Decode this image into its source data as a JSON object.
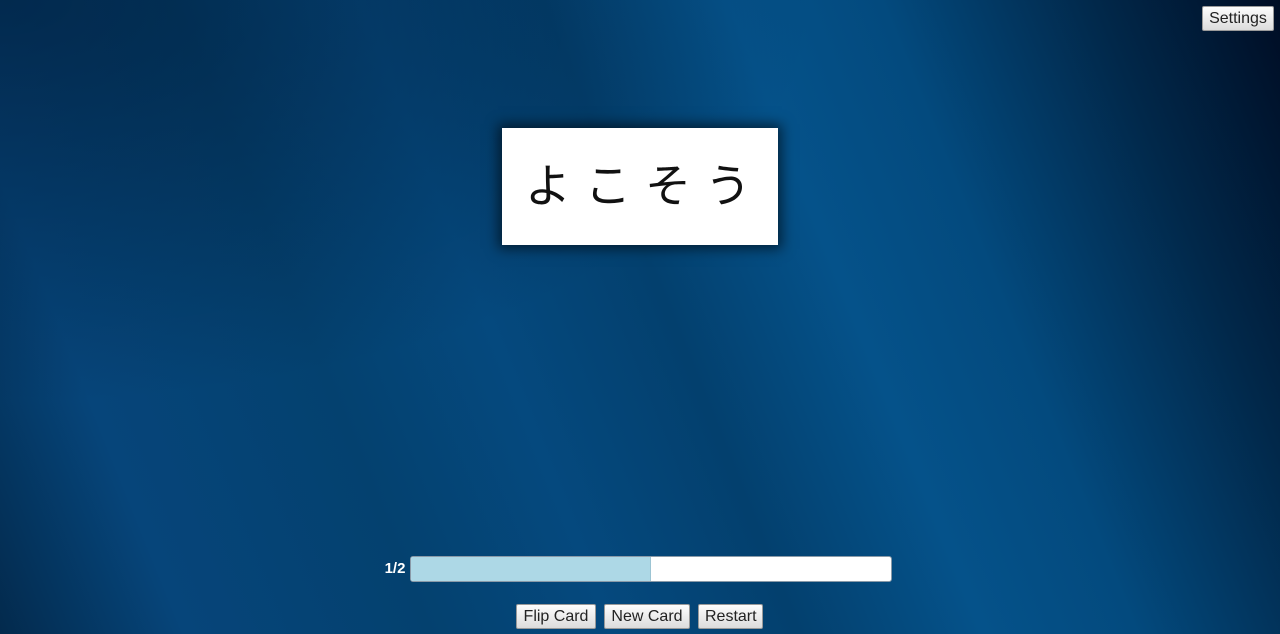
{
  "header": {
    "settings_label": "Settings"
  },
  "card": {
    "text": "よこそう"
  },
  "progress": {
    "label": "1/2",
    "fraction": 0.5
  },
  "controls": {
    "flip_label": "Flip Card",
    "new_label": "New Card",
    "restart_label": "Restart"
  },
  "colors": {
    "progress_fill": "#add8e6",
    "background_dark": "#032a4d",
    "background_mid": "#05497e"
  }
}
